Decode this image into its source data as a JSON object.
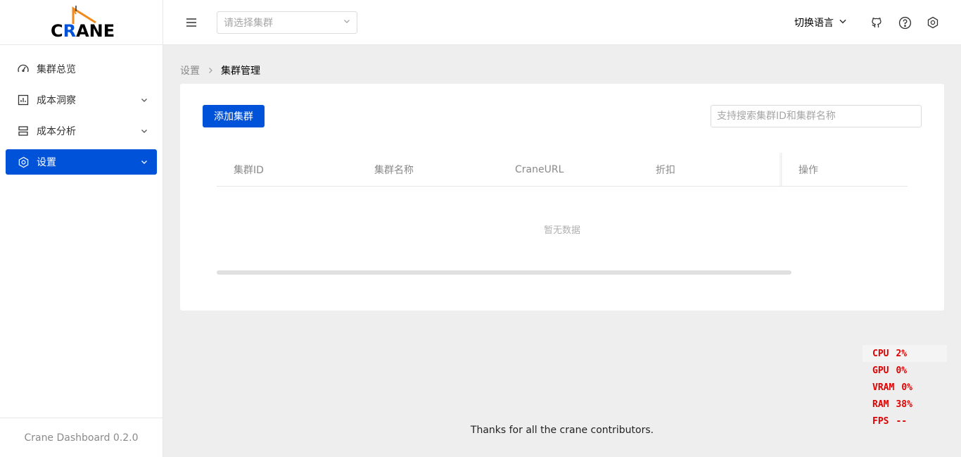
{
  "logo": {
    "text_a": "C",
    "text_hl": "R",
    "text_b": "ANE"
  },
  "sidebar": {
    "items": [
      {
        "label": "集群总览",
        "icon": "dashboard-icon",
        "has_children": false,
        "active": false
      },
      {
        "label": "成本洞察",
        "icon": "chart-icon",
        "has_children": true,
        "active": false
      },
      {
        "label": "成本分析",
        "icon": "layers-icon",
        "has_children": true,
        "active": false
      },
      {
        "label": "设置",
        "icon": "gear-icon",
        "has_children": true,
        "active": true
      }
    ],
    "footer": "Crane Dashboard 0.2.0"
  },
  "header": {
    "cluster_placeholder": "请选择集群",
    "language_label": "切换语言",
    "icons": [
      "github-icon",
      "help-icon",
      "settings-icon"
    ]
  },
  "breadcrumb": {
    "parent": "设置",
    "current": "集群管理"
  },
  "toolbar": {
    "add_label": "添加集群",
    "search_placeholder": "支持搜索集群ID和集群名称"
  },
  "table": {
    "columns": [
      "集群ID",
      "集群名称",
      "CraneURL",
      "折扣"
    ],
    "action_column": "操作",
    "empty_text": "暂无数据"
  },
  "footer": {
    "text": "Thanks for all the crane contributors."
  },
  "perf": [
    {
      "key": "CPU",
      "value": "2%"
    },
    {
      "key": "GPU",
      "value": "0%"
    },
    {
      "key": "VRAM",
      "value": "0%"
    },
    {
      "key": "RAM",
      "value": "38%"
    },
    {
      "key": "FPS",
      "value": "--"
    }
  ],
  "colors": {
    "primary": "#0052d9",
    "perf_text": "#e00000",
    "logo_orange": "#f28a1b"
  }
}
